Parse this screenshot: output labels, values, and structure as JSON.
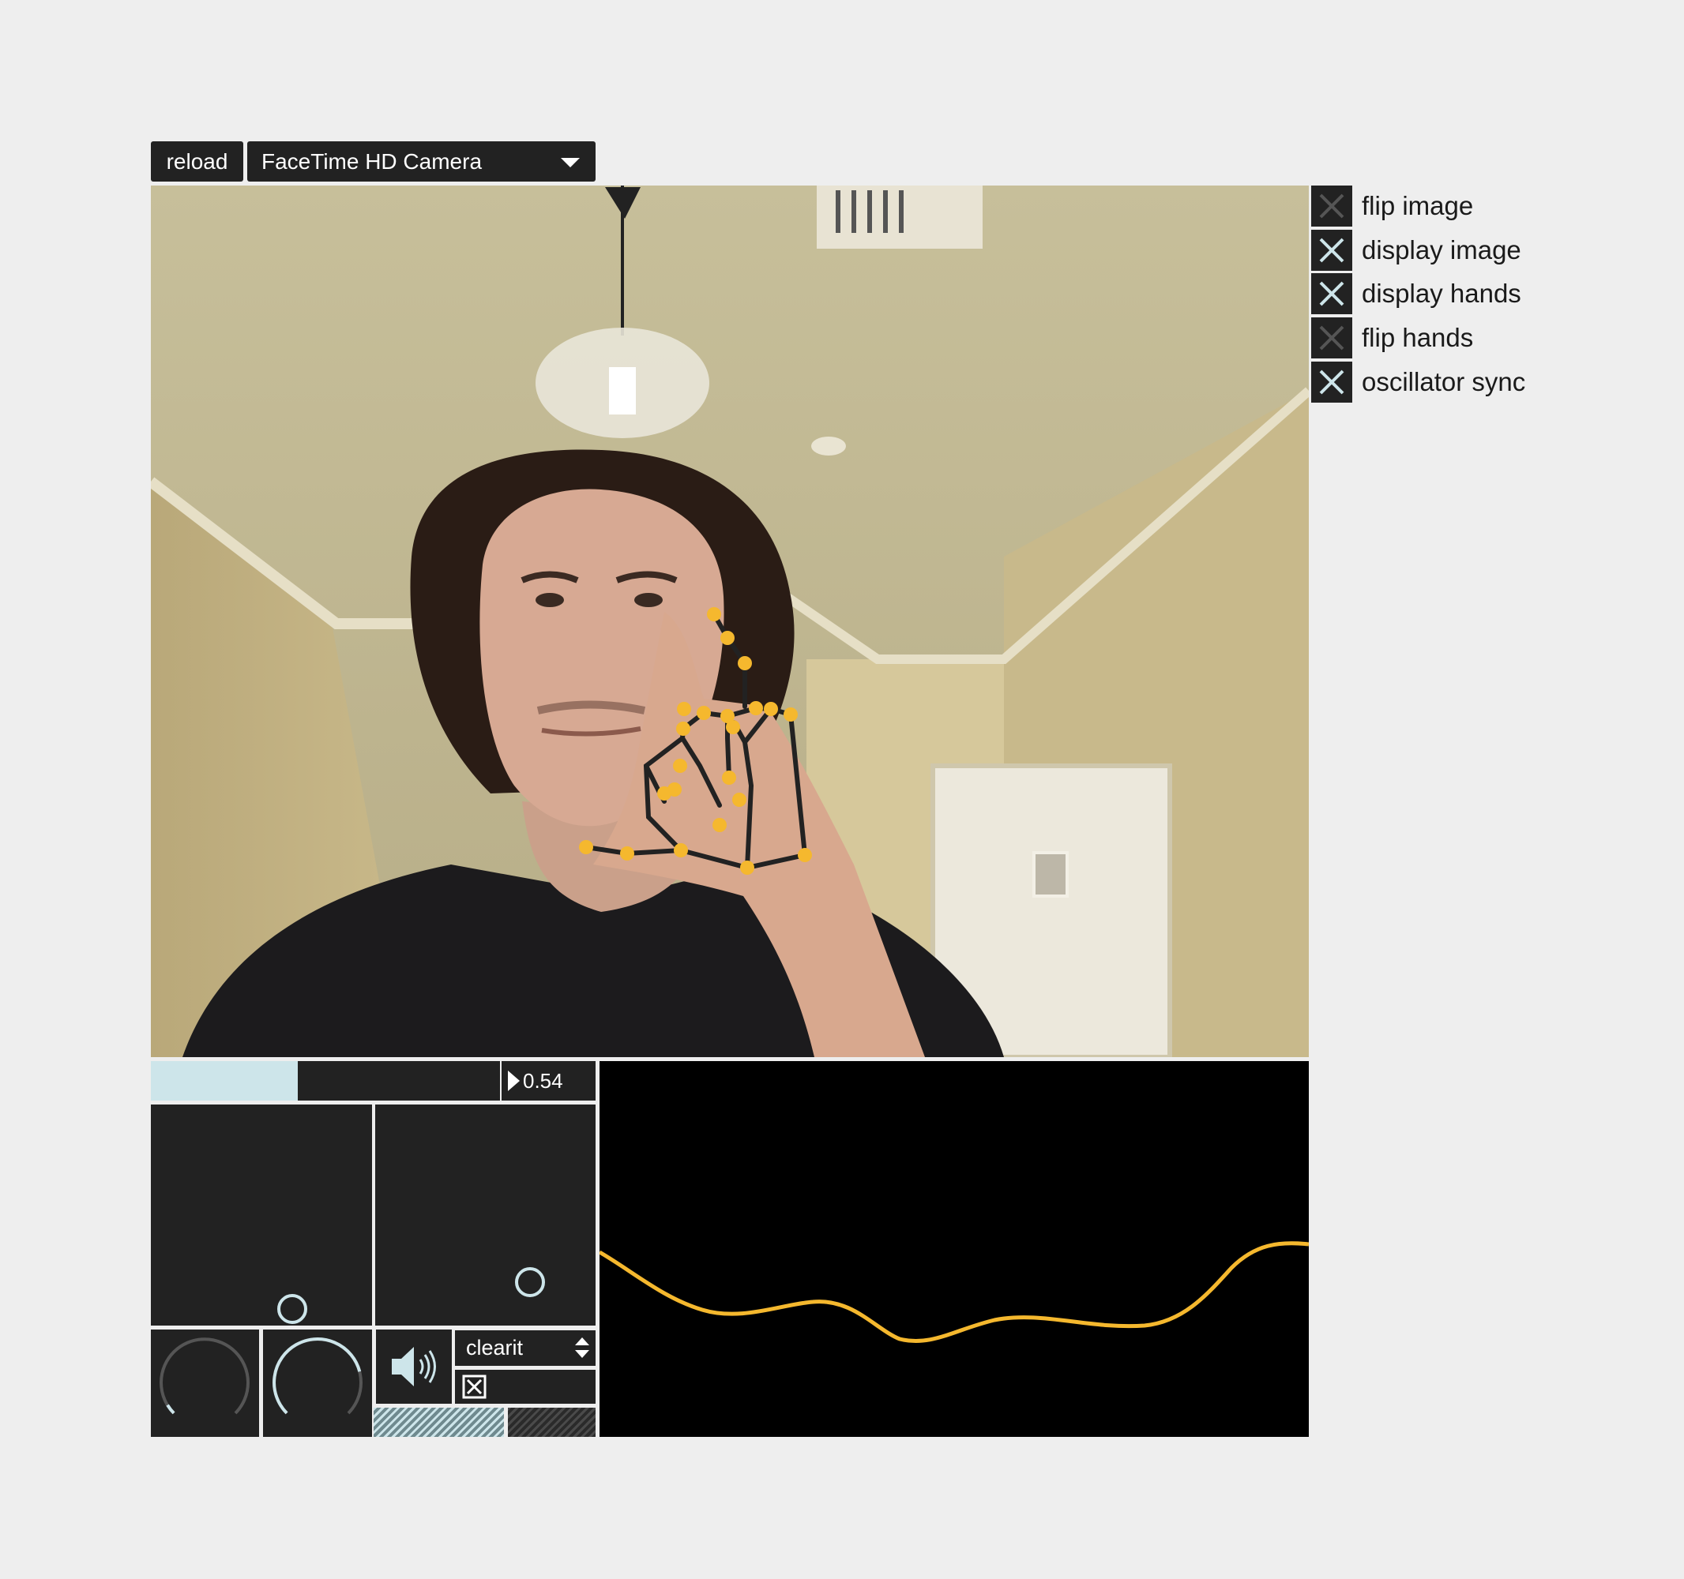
{
  "toolbar": {
    "reload_label": "reload",
    "camera_selected": "FaceTime HD Camera"
  },
  "options": [
    {
      "label": "flip image",
      "checked": false
    },
    {
      "label": "display image",
      "checked": true
    },
    {
      "label": "display hands",
      "checked": true
    },
    {
      "label": "flip hands",
      "checked": false
    },
    {
      "label": "oscillator sync",
      "checked": true
    }
  ],
  "controls": {
    "slider_value": 0.42,
    "number_value": "0.54",
    "dial_1_value": 0.05,
    "dial_2_value": 0.78,
    "menu_selected": "clearit",
    "toggle_checked": true
  },
  "colors": {
    "accent": "#cde5ea",
    "hand_landmark": "#f5b82e",
    "panel": "#222222",
    "waveform": "#f5b82e"
  },
  "icons": {
    "speaker": "speaker-icon",
    "dropdown": "chevron-down-icon"
  }
}
